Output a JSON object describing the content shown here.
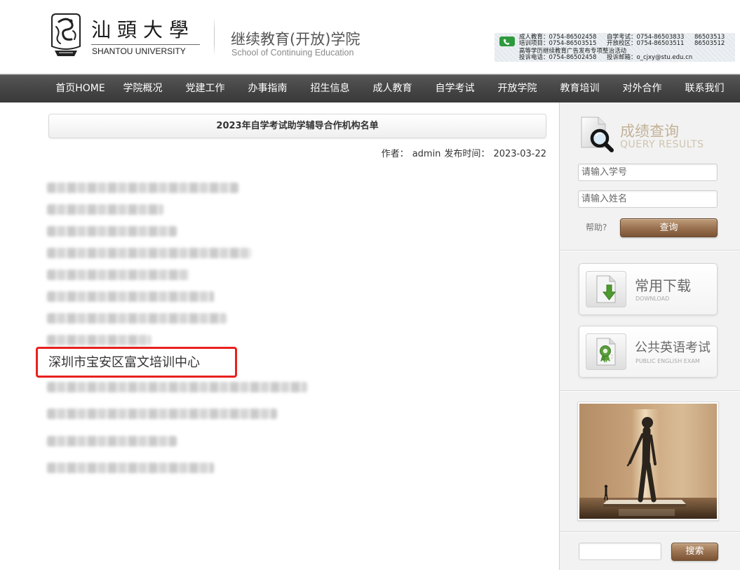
{
  "header": {
    "logo": {
      "emblem_icon": "university-emblem-icon",
      "name_cn": "汕頭大學",
      "name_en": "SHANTOU UNIVERSITY"
    },
    "school": {
      "name_cn": "继续教育(开放)学院",
      "name_en": "School of Continuing Education"
    },
    "contact": {
      "icon": "phone-icon",
      "rows": [
        [
          "成人教育：0754-86502458",
          "自学考试：0754-86503833",
          "86503513"
        ],
        [
          "培训项目：0754-86503515",
          "开放校区：0754-86503511",
          "86503512"
        ],
        [
          "高等学历继续教育广告发布专项整治活动"
        ],
        [
          "投诉电话：0754-86502458",
          "投诉邮箱：o_cjxy@stu.edu.cn"
        ]
      ]
    }
  },
  "nav": {
    "items": [
      "首页HOME",
      "学院概况",
      "党建工作",
      "办事指南",
      "招生信息",
      "成人教育",
      "自学考试",
      "开放学院",
      "教育培训",
      "对外合作",
      "联系我们"
    ]
  },
  "article": {
    "title": "2023年自学考试助学辅导合作机构名单",
    "author_label": "作者：",
    "author": "admin",
    "date_label": "发布时间：",
    "date": "2023-03-22",
    "entries": [
      {
        "blurred": true
      },
      {
        "blurred": true
      },
      {
        "blurred": true
      },
      {
        "blurred": true
      },
      {
        "blurred": true
      },
      {
        "blurred": true
      },
      {
        "blurred": true
      },
      {
        "blurred": true
      },
      {
        "text": "深圳市宝安区富文培训中心",
        "highlighted": true
      },
      {
        "blurred": true
      },
      {
        "blurred": true
      },
      {
        "blurred": true
      },
      {
        "blurred": true
      }
    ]
  },
  "sidebar": {
    "query": {
      "icon": "magnifier-document-icon",
      "title_cn": "成绩查询",
      "title_en": "QUERY RESULTS",
      "student_id_placeholder": "请输入学号",
      "name_placeholder": "请输入姓名",
      "help_label": "帮助?",
      "submit_label": "查询"
    },
    "links": [
      {
        "icon": "download-document-icon",
        "title_cn": "常用下载",
        "title_en": "DOWNLOAD"
      },
      {
        "icon": "certificate-document-icon",
        "title_cn": "公共英语考试",
        "title_en": "PUBLIC ENGLISH EXAM"
      }
    ],
    "photo": {
      "icon": "sculpture-photo"
    },
    "search": {
      "button_label": "搜索"
    }
  },
  "colors": {
    "nav_background": "#444444",
    "accent_brown": "#8b6342",
    "highlight_border": "#e8211d",
    "query_title": "#c2b298",
    "contact_icon_green": "#2e9a3e"
  }
}
